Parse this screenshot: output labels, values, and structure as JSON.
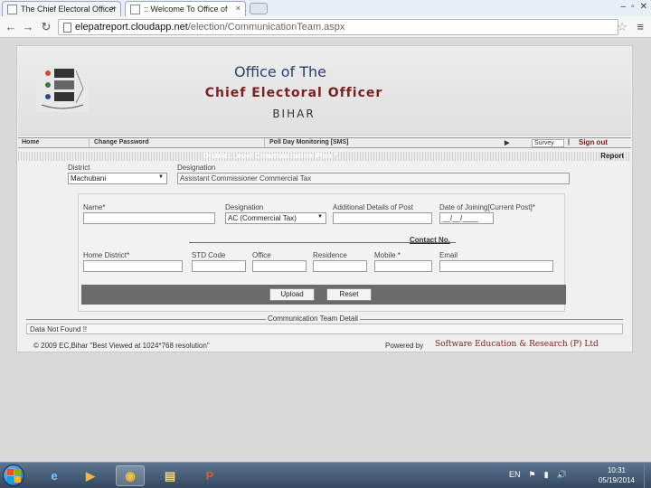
{
  "browser": {
    "tabs": [
      {
        "title": "The Chief Electoral Officer",
        "icon": "page-icon",
        "close": "×"
      },
      {
        "title": ":: Welcome To Office of",
        "icon": "page-icon",
        "close": "×"
      }
    ],
    "window_controls": [
      "–",
      "▫",
      "✕"
    ],
    "nav": {
      "back": "←",
      "forward": "→",
      "reload": "↻"
    },
    "url_host": "elepatreport.cloudapp.net",
    "url_path": "/election/CommunicationTeam.aspx",
    "star": "☆",
    "menu": "≡"
  },
  "banner": {
    "line1": "Office of The",
    "line2": "Chief Electoral Officer",
    "line3": "BIHAR"
  },
  "navbar": {
    "home": "Home",
    "change_password": "Change Password",
    "poll_day": "Poll Day Monitoring [SMS]",
    "arrow": "▶",
    "survey": "Survey",
    "sep": "|",
    "sign_out": "Sign out"
  },
  "plan": {
    "title": "District Level Communication Plan *",
    "report": "Report"
  },
  "form": {
    "district_label": "District",
    "district_value": "Machubani",
    "designation_top_label": "Designation",
    "designation_top_value": "Assistant Commissioner Commercial Tax",
    "name_label": "Name*",
    "designation_label": "Designation",
    "designation_value": "AC (Commercial Tax)",
    "additional_label": "Additional Details of Post",
    "doj_label": "Date of Joining[Current Post]*",
    "doj_value": "__/__/____",
    "contact_no": "Contact No.",
    "home_district_label": "Home District*",
    "std_label": "STD Code",
    "office_label": "Office",
    "residence_label": "Residence",
    "mobile_label": "Mobile *",
    "email_label": "Email",
    "upload": "Upload",
    "reset": "Reset"
  },
  "detail": {
    "title": "Communication Team Detail",
    "message": "Data Not Found !!"
  },
  "footer": {
    "copyright": "© 2009 EC,Bihar \"Best Viewed at 1024*768 resolution\"",
    "powered_by": "Powered by",
    "company": "Software Education & Research (P) Ltd"
  },
  "taskbar": {
    "apps": [
      {
        "name": "ie-icon",
        "glyph": "e",
        "color": "#7fc4ff"
      },
      {
        "name": "media-player-icon",
        "glyph": "▶",
        "color": "#f5b44a"
      },
      {
        "name": "chrome-icon",
        "glyph": "◉",
        "color": "#f0c23a"
      },
      {
        "name": "explorer-icon",
        "glyph": "▤",
        "color": "#f2d47a"
      },
      {
        "name": "powerpoint-icon",
        "glyph": "P",
        "color": "#e4572e"
      }
    ],
    "tray": [
      "EN",
      "⚑",
      "▮",
      "🔊"
    ],
    "time": "10:31",
    "date": "05/19/2014"
  }
}
